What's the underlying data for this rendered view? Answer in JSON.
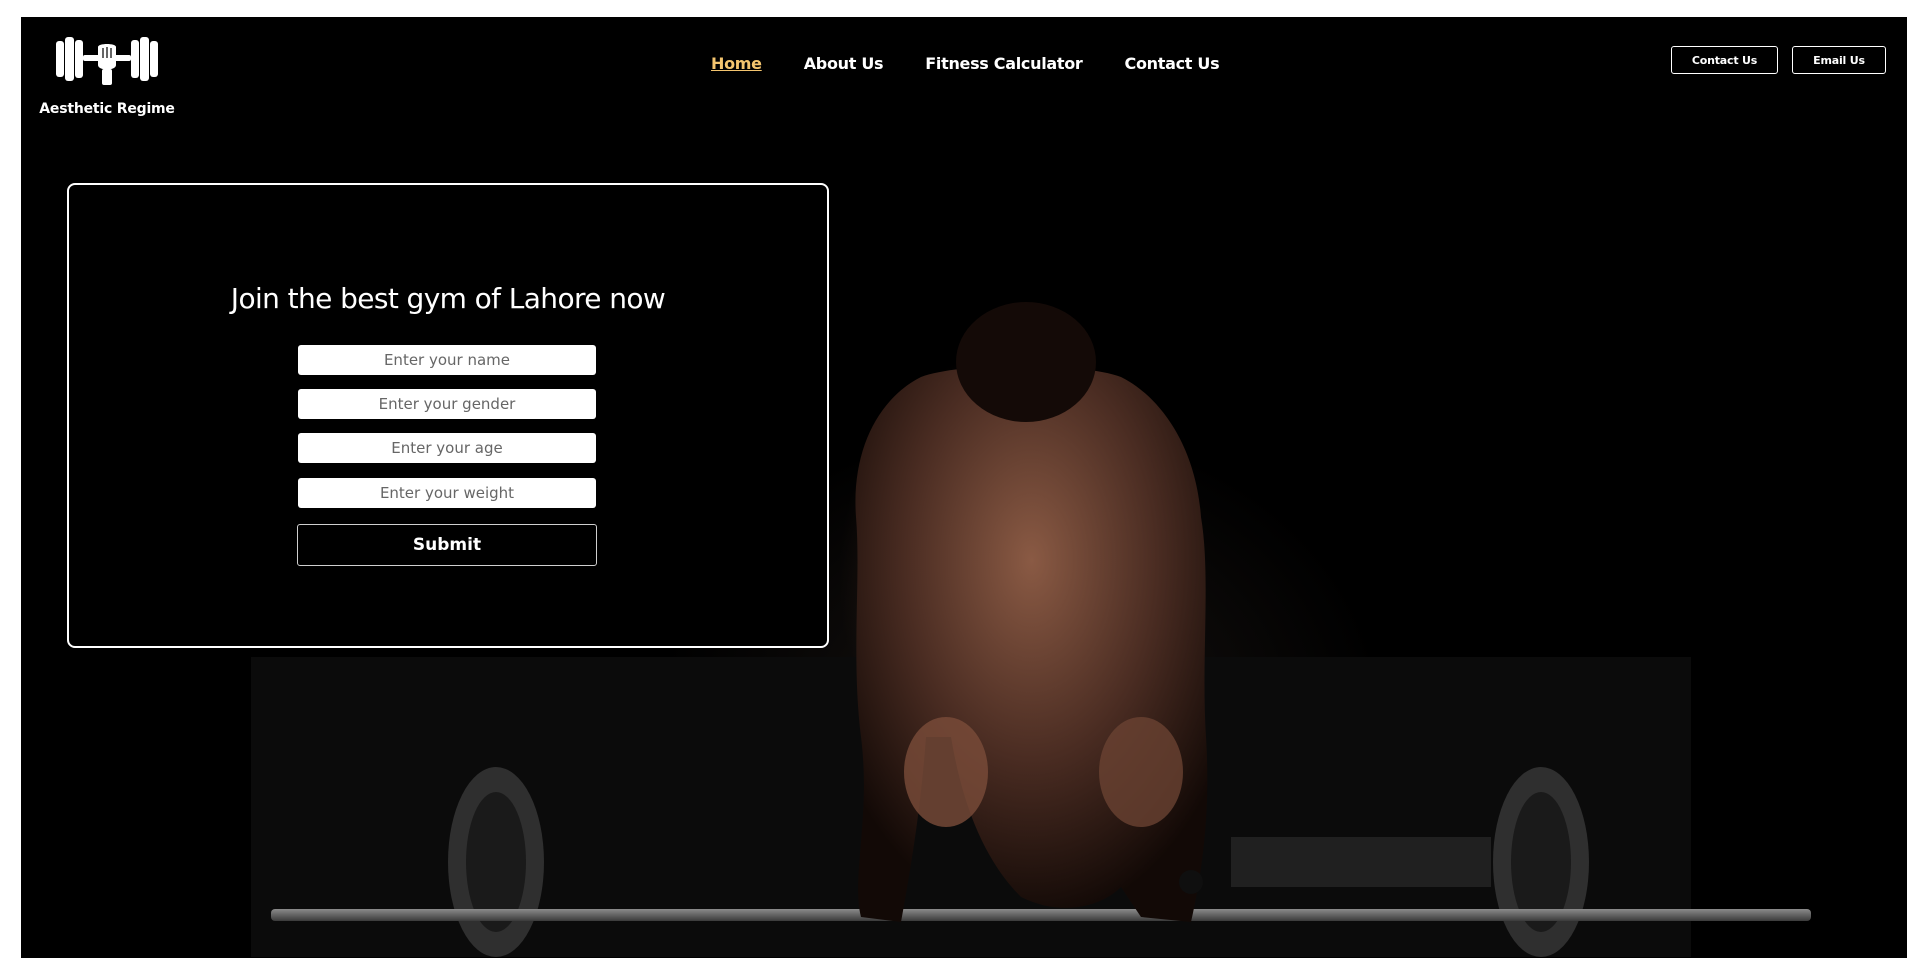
{
  "brand": {
    "name": "Aesthetic Regime",
    "logo_icon": "dumbbell-fist-icon"
  },
  "nav": {
    "items": [
      {
        "label": "Home",
        "active": true
      },
      {
        "label": "About Us",
        "active": false
      },
      {
        "label": "Fitness Calculator",
        "active": false
      },
      {
        "label": "Contact Us",
        "active": false
      }
    ]
  },
  "header_buttons": {
    "contact_label": "Contact Us",
    "email_label": "Email Us"
  },
  "signup_form": {
    "title": "Join the best gym of Lahore now",
    "fields": {
      "name_placeholder": "Enter your name",
      "gender_placeholder": "Enter your gender",
      "age_placeholder": "Enter your age",
      "weight_placeholder": "Enter your weight"
    },
    "submit_label": "Submit"
  },
  "colors": {
    "background": "#000000",
    "text": "#ffffff",
    "nav_active": "#f4c56f"
  }
}
